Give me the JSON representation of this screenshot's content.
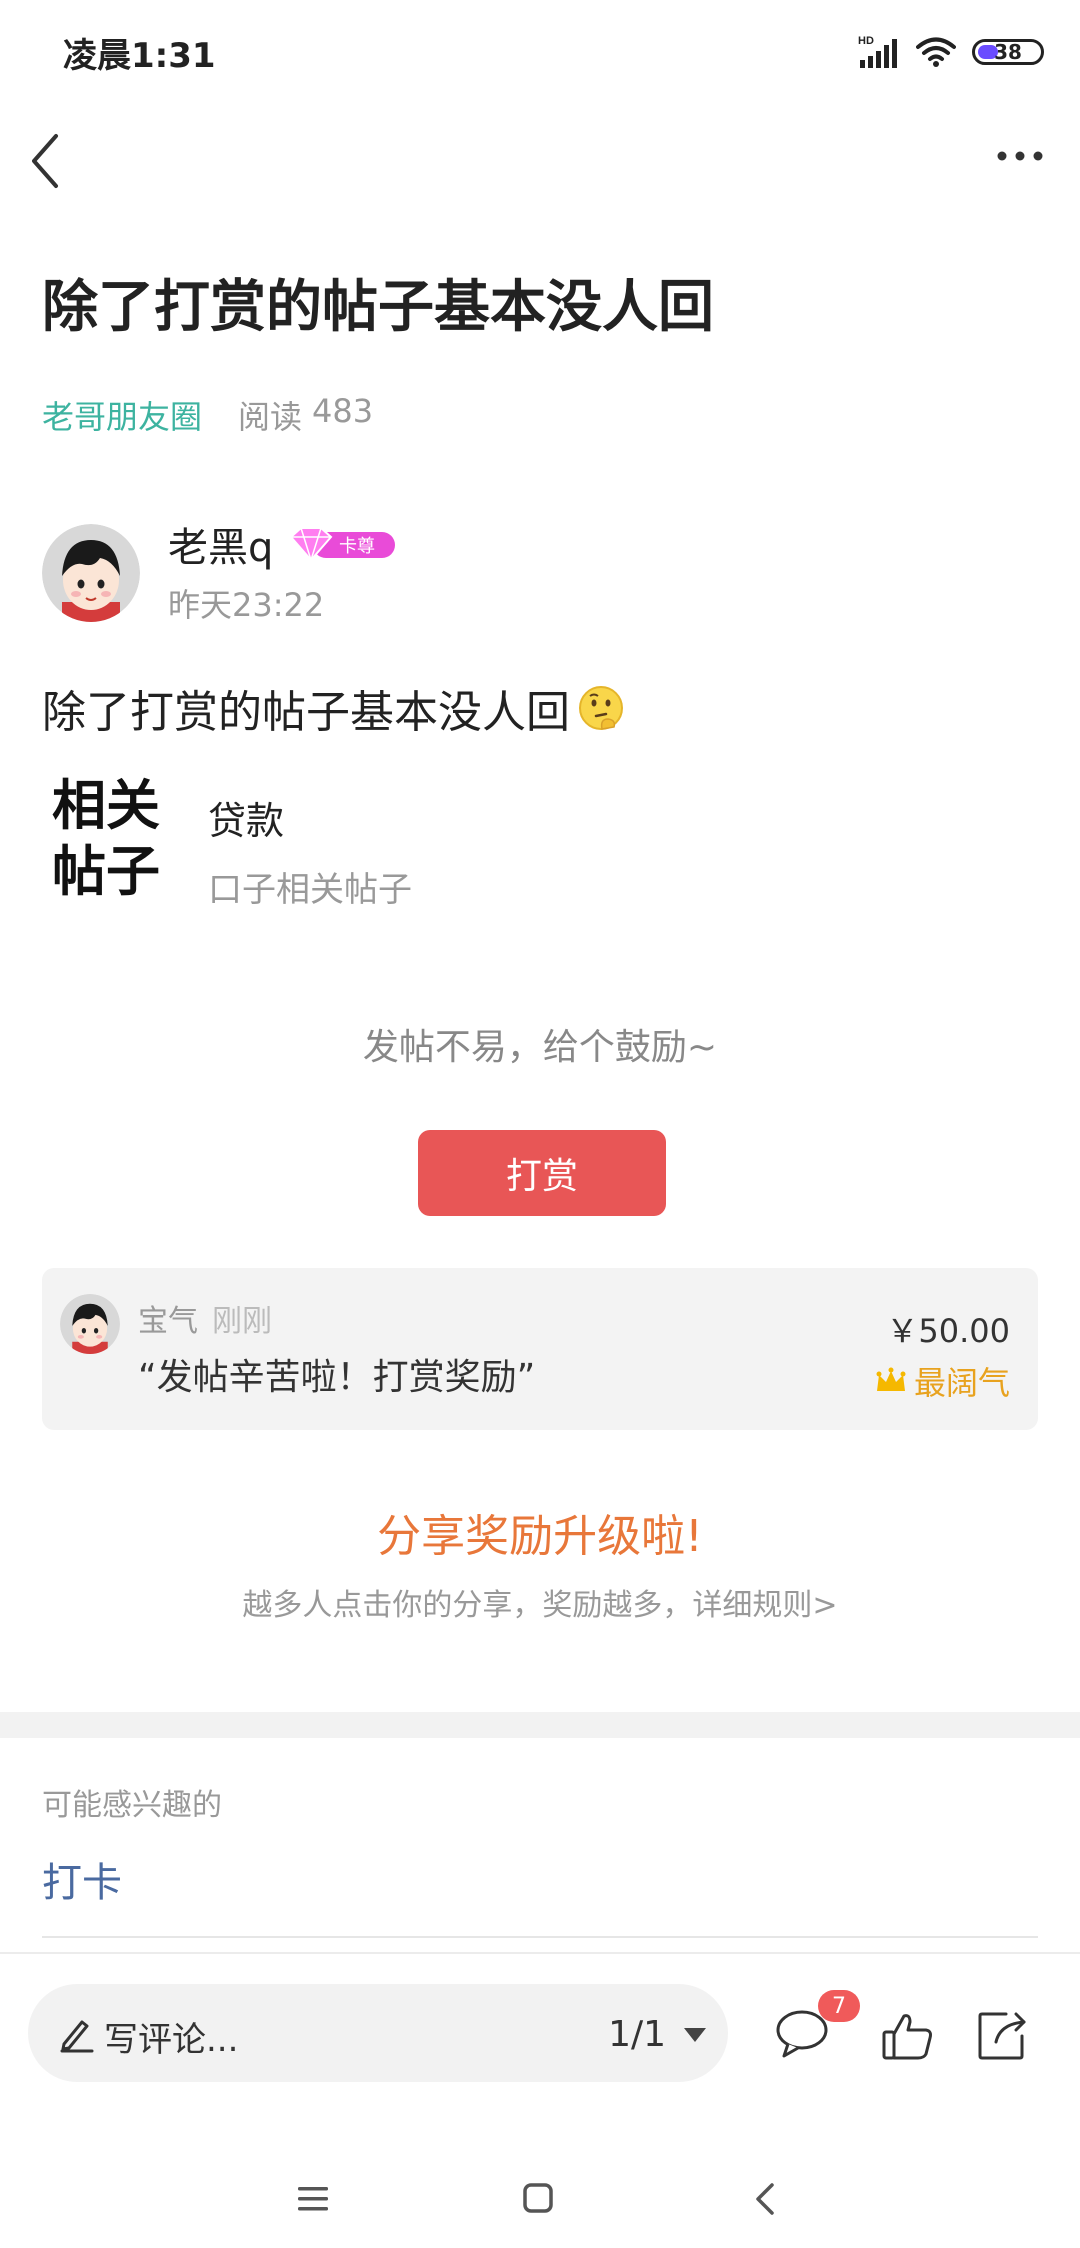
{
  "status_bar": {
    "time": "凌晨1:31",
    "network": "HD",
    "battery": "38",
    "battery_color": "#6a4cff"
  },
  "nav": {
    "back_icon": "chevron-left-icon",
    "more_icon": "more-horizontal-icon"
  },
  "post": {
    "title": "除了打赏的帖子基本没人回",
    "circle": "老哥朋友圈",
    "read_label": "阅读",
    "read_count": "483",
    "author": {
      "name": "老黑q",
      "badge": "卡尊",
      "time": "昨天23:22"
    },
    "body": "除了打赏的帖子基本没人回",
    "body_emoji": "thinking-face-icon",
    "related": {
      "label": "相关帖子",
      "tag": "贷款",
      "sub": "口子相关帖子"
    }
  },
  "reward": {
    "encourage_text": "发帖不易，给个鼓励~",
    "button_label": "打赏",
    "button_color": "#e85656",
    "record": {
      "user": "宝气",
      "time": "刚刚",
      "message": "“发帖辛苦啦！打赏奖励”",
      "amount": "￥50.00",
      "title": "最阔气",
      "title_color": "#e8a21e"
    }
  },
  "share": {
    "title": "分享奖励升级啦!",
    "desc": "越多人点击你的分享，奖励越多，详细规则>",
    "title_color": "#e8773a"
  },
  "interest": {
    "label": "可能感兴趣的",
    "items": [
      "打卡"
    ]
  },
  "bottom_bar": {
    "comment_placeholder": "写评论...",
    "page_indicator": "1/1",
    "comment_count": "7",
    "icons": [
      "pen-icon",
      "comment-icon",
      "like-icon",
      "share-icon"
    ]
  }
}
